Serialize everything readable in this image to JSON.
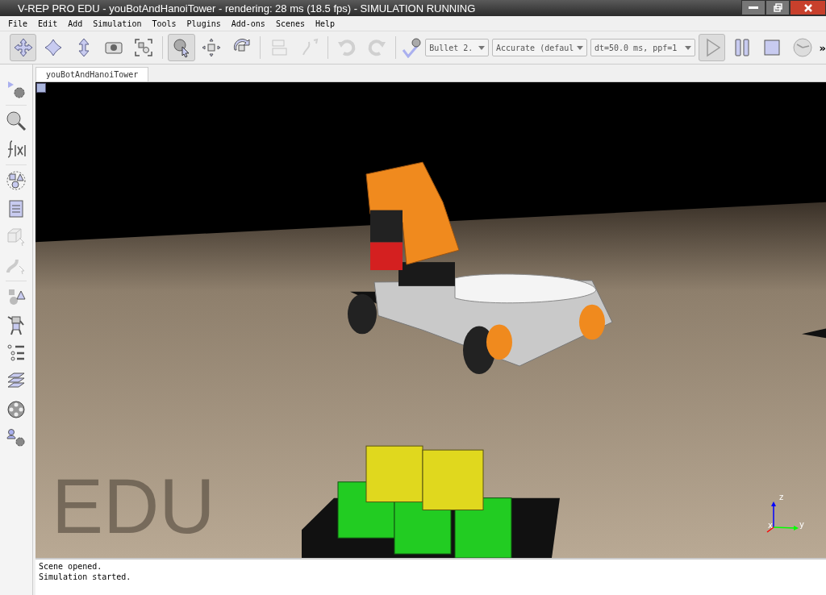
{
  "window": {
    "title": "V-REP PRO EDU - youBotAndHanoiTower - rendering: 28 ms (18.5 fps) - SIMULATION RUNNING"
  },
  "menu": [
    "File",
    "Edit",
    "Add",
    "Simulation",
    "Tools",
    "Plugins",
    "Add-ons",
    "Scenes",
    "Help"
  ],
  "toolbar": {
    "groups": [
      [
        {
          "selected": true,
          "disabled": false
        },
        {
          "selected": false,
          "disabled": false
        },
        {
          "selected": false,
          "disabled": false
        },
        {
          "selected": false,
          "disabled": false
        },
        {
          "selected": false,
          "disabled": false
        }
      ],
      [
        {
          "selected": true,
          "disabled": false
        },
        {
          "selected": false,
          "disabled": false
        },
        {
          "selected": false,
          "disabled": false
        }
      ],
      [
        {
          "selected": false,
          "disabled": true
        },
        {
          "selected": false,
          "disabled": true
        }
      ],
      [
        {
          "selected": false,
          "disabled": true
        },
        {
          "selected": false,
          "disabled": true
        }
      ]
    ],
    "engine": "Bullet 2.",
    "accuracy": "Accurate (defaul",
    "timestep": "dt=50.0 ms, ppf=1",
    "sim_controls": [
      {
        "kind": "play",
        "selected": true
      },
      {
        "kind": "pause",
        "selected": false
      },
      {
        "kind": "stop",
        "selected": false
      },
      {
        "kind": "realtime",
        "selected": false
      }
    ],
    "overflow": "»"
  },
  "tabs": [
    {
      "label": "youBotAndHanoiTower",
      "selected": true
    }
  ],
  "sidebar": {
    "groups": [
      [
        {
          "disabled": false
        }
      ],
      [
        {
          "disabled": false
        },
        {
          "disabled": false
        }
      ],
      [
        {
          "disabled": false
        },
        {
          "disabled": false
        },
        {
          "disabled": true
        },
        {
          "disabled": true
        }
      ],
      [
        {
          "disabled": false
        },
        {
          "disabled": false
        },
        {
          "disabled": false
        },
        {
          "disabled": false
        },
        {
          "disabled": false
        },
        {
          "disabled": false
        }
      ]
    ]
  },
  "viewport": {
    "overlay": "EDU",
    "axes": {
      "z": "z",
      "x": "x",
      "y": "y"
    }
  },
  "console": [
    "Scene opened.",
    "Simulation started."
  ]
}
